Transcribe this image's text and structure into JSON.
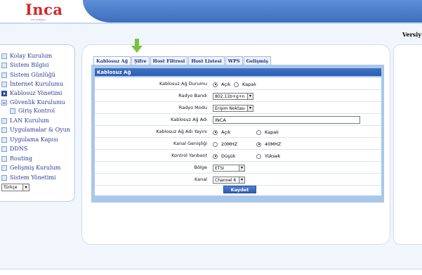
{
  "header": {
    "logo": "Inca",
    "logo_subtitle": "Inca Software",
    "version_label": "Versiy"
  },
  "sidebar": {
    "items": [
      {
        "label": "Kolay Kurulum"
      },
      {
        "label": "Sistem Bilgisi"
      },
      {
        "label": "Sistem Günlüğü"
      },
      {
        "label": "İnternet Kurulumu"
      },
      {
        "label": "Kablosuz Yönetimi"
      },
      {
        "label": "Güvenlik Kurulumu"
      },
      {
        "label": "Giriş Kontrol"
      },
      {
        "label": "LAN Kurulum"
      },
      {
        "label": "Uygulamalar & Oyun"
      },
      {
        "label": "Uygulama Kapısı"
      },
      {
        "label": "DDNS"
      },
      {
        "label": "Routing"
      },
      {
        "label": "Gelişmiş Kurulum"
      },
      {
        "label": "Sistem Yönetimi"
      }
    ],
    "language": "Türkçe"
  },
  "tabs": [
    {
      "label": "Kablosuz Ağ"
    },
    {
      "label": "Şifre"
    },
    {
      "label": "Host Filtresi"
    },
    {
      "label": "Host Listesi"
    },
    {
      "label": "WPS"
    },
    {
      "label": "Gelişmiş"
    }
  ],
  "panel": {
    "title": "Kablosuz Ağ",
    "rows": {
      "status": {
        "label": "Kablosuz Ağ Durumu",
        "opt1": "Açık",
        "opt2": "Kapalı"
      },
      "band": {
        "label": "Radyo Bandı",
        "value": "802.11b+g+n"
      },
      "mode": {
        "label": "Radyo Modu",
        "value": "Erişim Noktası"
      },
      "ssid": {
        "label": "Kablosuz Ağ Adı",
        "value": "INCA"
      },
      "broadcast": {
        "label": "Kablosuz Ağ Adı Yayını",
        "opt1": "Açık",
        "opt2": "Kapalı"
      },
      "width": {
        "label": "Kanal Genişliği",
        "opt1": "20MHZ",
        "opt2": "40MHZ"
      },
      "sideband": {
        "label": "Kontrol Yanbant",
        "opt1": "Düşük",
        "opt2": "Yüksek"
      },
      "region": {
        "label": "Bölge",
        "value": "ETSI"
      },
      "channel": {
        "label": "Kanal",
        "value": "Channel 6"
      }
    },
    "save_label": "Kaydet"
  }
}
